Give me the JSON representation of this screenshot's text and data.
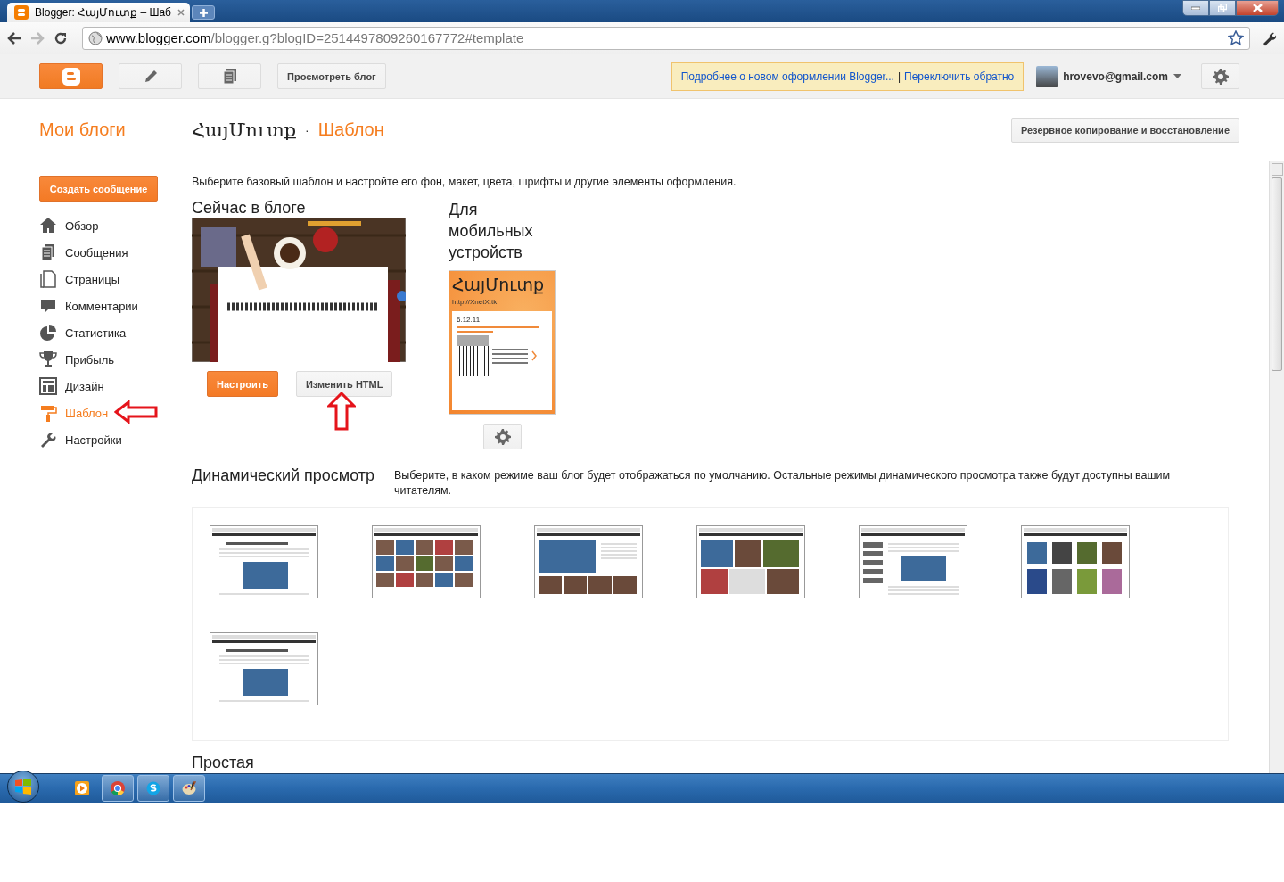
{
  "browser": {
    "tab_title": "Blogger: ՀայՄուտք – Шаб",
    "url_host": "www.blogger.com",
    "url_path": "/blogger.g?blogID=2514497809260167772#template"
  },
  "toolbar": {
    "view_blog": "Просмотреть блог",
    "notice_link": "Подробнее о новом оформлении Blogger...",
    "notice_separator": "|",
    "switch_back": "Переключить обратно",
    "account": "hrovevo@gmail.com"
  },
  "header": {
    "my_blogs": "Мои блоги",
    "blog_name": "ՀայՄուտք",
    "separator": "·",
    "page_title": "Шаблон",
    "backup_button": "Резервное копирование и восстановление"
  },
  "sidebar": {
    "create_button": "Создать сообщение",
    "items": [
      {
        "label": "Обзор",
        "kind": "overview",
        "selected": false
      },
      {
        "label": "Сообщения",
        "kind": "posts",
        "selected": false
      },
      {
        "label": "Страницы",
        "kind": "pages",
        "selected": false
      },
      {
        "label": "Комментарии",
        "kind": "comments",
        "selected": false
      },
      {
        "label": "Статистика",
        "kind": "stats",
        "selected": false
      },
      {
        "label": "Прибыль",
        "kind": "earnings",
        "selected": false
      },
      {
        "label": "Дизайн",
        "kind": "layout",
        "selected": false
      },
      {
        "label": "Шаблон",
        "kind": "template",
        "selected": true
      },
      {
        "label": "Настройки",
        "kind": "settings",
        "selected": false
      }
    ]
  },
  "main": {
    "intro": "Выберите базовый шаблон и настройте его фон, макет, цвета, шрифты и другие элементы оформления.",
    "current": {
      "heading": "Сейчас в блоге",
      "customize_button": "Настроить",
      "edit_html_button": "Изменить HTML"
    },
    "mobile": {
      "heading": "Для мобильных устройств",
      "preview_title": "ՀայՄուտք",
      "preview_url": "http://XnetX.tk",
      "preview_date": "6.12.11"
    },
    "dynamic": {
      "heading": "Динамический просмотр",
      "description": "Выберите, в каком режиме ваш блог будет отображаться по умолчанию. Остальные режимы динамического просмотра также будут доступны вашим читателям.",
      "thumbnails": [
        {
          "kind": "list"
        },
        {
          "kind": "grid"
        },
        {
          "kind": "feature"
        },
        {
          "kind": "mosaic"
        },
        {
          "kind": "sidebar"
        },
        {
          "kind": "tiles"
        },
        {
          "kind": "list"
        }
      ]
    },
    "next_heading": "Простая"
  },
  "taskbar": {
    "apps": [
      {
        "kind": "media",
        "running": false
      },
      {
        "kind": "browser",
        "running": true
      },
      {
        "kind": "messenger",
        "running": true
      },
      {
        "kind": "paint",
        "running": true
      }
    ]
  }
}
